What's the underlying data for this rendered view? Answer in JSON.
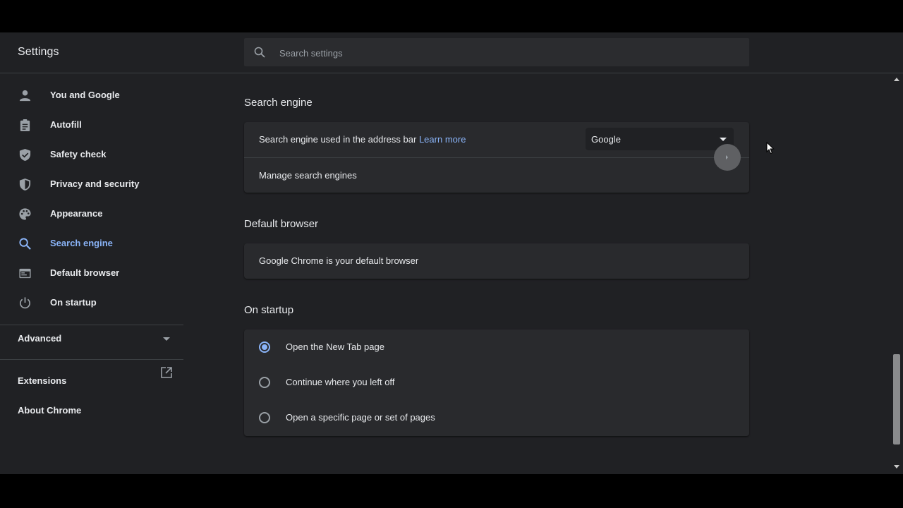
{
  "header": {
    "title": "Settings",
    "search_placeholder": "Search settings"
  },
  "sidebar": {
    "items": [
      {
        "label": "You and Google",
        "icon": "person-icon"
      },
      {
        "label": "Autofill",
        "icon": "clipboard-icon"
      },
      {
        "label": "Safety check",
        "icon": "shield-check-icon"
      },
      {
        "label": "Privacy and security",
        "icon": "shield-icon"
      },
      {
        "label": "Appearance",
        "icon": "palette-icon"
      },
      {
        "label": "Search engine",
        "icon": "search-icon",
        "active": true
      },
      {
        "label": "Default browser",
        "icon": "browser-icon"
      },
      {
        "label": "On startup",
        "icon": "power-icon"
      }
    ],
    "advanced_label": "Advanced",
    "extensions_label": "Extensions",
    "about_label": "About Chrome"
  },
  "search_engine": {
    "title": "Search engine",
    "address_bar_text": "Search engine used in the address bar",
    "learn_more": "Learn more",
    "selected_engine": "Google",
    "manage_label": "Manage search engines"
  },
  "default_browser": {
    "title": "Default browser",
    "status_text": "Google Chrome is your default browser"
  },
  "on_startup": {
    "title": "On startup",
    "options": [
      {
        "label": "Open the New Tab page",
        "checked": true
      },
      {
        "label": "Continue where you left off",
        "checked": false
      },
      {
        "label": "Open a specific page or set of pages",
        "checked": false
      }
    ]
  },
  "colors": {
    "background": "#202124",
    "card": "#292a2d",
    "accent": "#8ab4f8",
    "text": "#e8eaed",
    "muted": "#9aa0a6"
  }
}
